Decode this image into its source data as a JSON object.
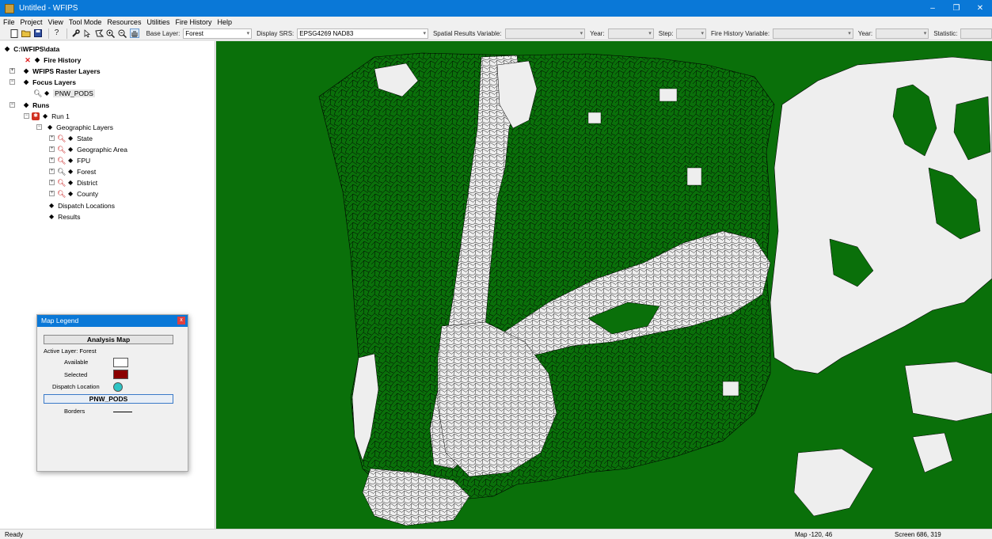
{
  "window": {
    "title": "Untitled - WFIPS",
    "minimize": "–",
    "restore": "❐",
    "close": "✕"
  },
  "menu": [
    "File",
    "Project",
    "View",
    "Tool Mode",
    "Resources",
    "Utilities",
    "Fire History",
    "Help"
  ],
  "toolbar": {
    "icons": [
      "new-file-icon",
      "open-folder-icon",
      "save-icon",
      "help-icon",
      "wrench-icon",
      "select-arrow-icon",
      "polygon-select-icon",
      "zoom-in-icon",
      "zoom-out-icon",
      "pan-hand-icon"
    ],
    "base_layer_label": "Base Layer:",
    "base_layer_value": "Forest",
    "display_srs_label": "Display SRS:",
    "display_srs_value": "EPSG4269 NAD83",
    "spatial_results_label": "Spatial Results Variable:",
    "spatial_results_value": "",
    "year_label": "Year:",
    "year_value": "",
    "step_label": "Step:",
    "step_value": "",
    "fire_history_var_label": "Fire History Variable:",
    "fire_history_var_value": "",
    "year2_label": "Year:",
    "year2_value": "",
    "statistic_label": "Statistic:",
    "statistic_value": ""
  },
  "tree": {
    "root": "C:\\WFIPS\\data",
    "fire_history": "Fire History",
    "raster_layers": "WFIPS Raster Layers",
    "focus_layers": "Focus Layers",
    "pnw_pods": "PNW_PODS",
    "runs": "Runs",
    "run1": "Run 1",
    "geographic_layers": "Geographic Layers",
    "state": "State",
    "geographic_area": "Geographic Area",
    "fpu": "FPU",
    "forest": "Forest",
    "district": "District",
    "county": "County",
    "dispatch_locations": "Dispatch Locations",
    "results": "Results"
  },
  "legend": {
    "title": "Map Legend",
    "close": "x",
    "analysis_map": "Analysis Map",
    "active_layer": "Active Layer: Forest",
    "available": "Available",
    "selected": "Selected",
    "dispatch_location": "Dispatch Location",
    "pnw_pods": "PNW_PODS",
    "borders": "Borders",
    "colors": {
      "available": "#ffffff",
      "selected": "#8b0000",
      "dispatch": "#2ec4c4"
    }
  },
  "map": {
    "colors": {
      "forest": "#0a700a",
      "available": "#eeeeee",
      "borders": "#000000"
    }
  },
  "status": {
    "ready": "Ready",
    "map_coords": "Map -120, 46",
    "screen_coords": "Screen 686, 319"
  }
}
